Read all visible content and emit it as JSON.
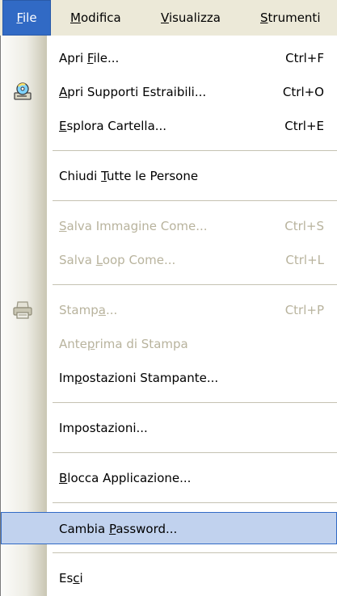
{
  "menubar": {
    "items": [
      {
        "label": "File",
        "accel": "F",
        "rest": "ile"
      },
      {
        "label": "Modifica",
        "accel": "M",
        "rest": "odifica"
      },
      {
        "label": "Visualizza",
        "accel": "V",
        "rest": "isualizza"
      },
      {
        "label": "Strumenti",
        "accel": "S",
        "rest": "trumenti"
      }
    ]
  },
  "menu": {
    "items": [
      {
        "pre": "Apri ",
        "accel": "F",
        "post": "ile...",
        "shortcut": "Ctrl+F"
      },
      {
        "pre": "",
        "accel": "A",
        "post": "pri Supporti Estraibili...",
        "shortcut": "Ctrl+O",
        "icon": "removable-media-icon"
      },
      {
        "pre": "",
        "accel": "E",
        "post": "splora Cartella...",
        "shortcut": "Ctrl+E"
      },
      {
        "pre": "Chiudi ",
        "accel": "T",
        "post": "utte le Persone",
        "shortcut": ""
      },
      {
        "pre": "",
        "accel": "S",
        "post": "alva Immagine Come...",
        "shortcut": "Ctrl+S"
      },
      {
        "pre": "Salva ",
        "accel": "L",
        "post": "oop Come...",
        "shortcut": "Ctrl+L"
      },
      {
        "pre": "Stamp",
        "accel": "a",
        "post": "...",
        "shortcut": "Ctrl+P",
        "icon": "printer-icon"
      },
      {
        "pre": "Ante",
        "accel": "p",
        "post": "rima di Stampa",
        "shortcut": ""
      },
      {
        "pre": "Im",
        "accel": "p",
        "post": "ostazioni Stampante...",
        "shortcut": ""
      },
      {
        "pre": "Impostazioni...",
        "accel": "",
        "post": "",
        "shortcut": ""
      },
      {
        "pre": "",
        "accel": "B",
        "post": "locca Applicazione...",
        "shortcut": ""
      },
      {
        "pre": "Cambia ",
        "accel": "P",
        "post": "assword...",
        "shortcut": ""
      },
      {
        "pre": "Es",
        "accel": "c",
        "post": "i",
        "shortcut": ""
      }
    ]
  }
}
